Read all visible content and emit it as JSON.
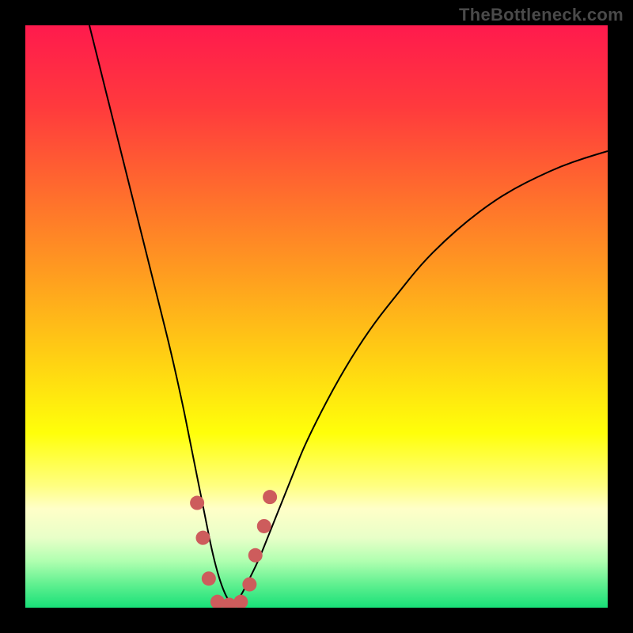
{
  "watermark": "TheBottleneck.com",
  "chart_data": {
    "type": "line",
    "title": "",
    "xlabel": "",
    "ylabel": "",
    "xlim": [
      0,
      100
    ],
    "ylim": [
      0,
      100
    ],
    "legend": false,
    "grid": false,
    "background_gradient": {
      "direction": "vertical",
      "stops": [
        {
          "offset": 0.0,
          "color": "#ff1a4d"
        },
        {
          "offset": 0.14,
          "color": "#ff3a3d"
        },
        {
          "offset": 0.28,
          "color": "#ff6a2e"
        },
        {
          "offset": 0.42,
          "color": "#ff9a20"
        },
        {
          "offset": 0.56,
          "color": "#ffcc14"
        },
        {
          "offset": 0.7,
          "color": "#ffff0a"
        },
        {
          "offset": 0.79,
          "color": "#ffff80"
        },
        {
          "offset": 0.83,
          "color": "#ffffc8"
        },
        {
          "offset": 0.88,
          "color": "#e8ffc8"
        },
        {
          "offset": 0.92,
          "color": "#b0ffb0"
        },
        {
          "offset": 0.96,
          "color": "#60f090"
        },
        {
          "offset": 1.0,
          "color": "#18e078"
        }
      ]
    },
    "series": [
      {
        "name": "bottleneck-curve",
        "color": "#000000",
        "stroke_width": 2,
        "x": [
          11,
          13,
          15,
          17,
          19,
          21,
          23,
          25,
          27,
          28,
          29,
          30,
          31,
          32,
          33,
          34,
          35,
          36,
          37,
          38,
          40,
          42,
          44,
          46,
          48,
          52,
          56,
          60,
          64,
          68,
          72,
          76,
          80,
          84,
          88,
          92,
          96,
          100
        ],
        "values": [
          100,
          92,
          84,
          76,
          68,
          60,
          52,
          44,
          35,
          30,
          25,
          20,
          15,
          10,
          6,
          3,
          1,
          1,
          2,
          4,
          8,
          13,
          18,
          23,
          28,
          36,
          43,
          49,
          54,
          59,
          63,
          66.5,
          69.5,
          72,
          74,
          75.8,
          77.2,
          78.4
        ]
      }
    ],
    "markers": {
      "name": "highlight-minimum",
      "color": "#cd5c5c",
      "radius": 9,
      "points": [
        {
          "x": 29.5,
          "y": 18
        },
        {
          "x": 30.5,
          "y": 12
        },
        {
          "x": 31.5,
          "y": 5
        },
        {
          "x": 33.0,
          "y": 1
        },
        {
          "x": 35.0,
          "y": 0.5
        },
        {
          "x": 37.0,
          "y": 1
        },
        {
          "x": 38.5,
          "y": 4
        },
        {
          "x": 39.5,
          "y": 9
        },
        {
          "x": 41.0,
          "y": 14
        },
        {
          "x": 42.0,
          "y": 19
        }
      ]
    }
  }
}
